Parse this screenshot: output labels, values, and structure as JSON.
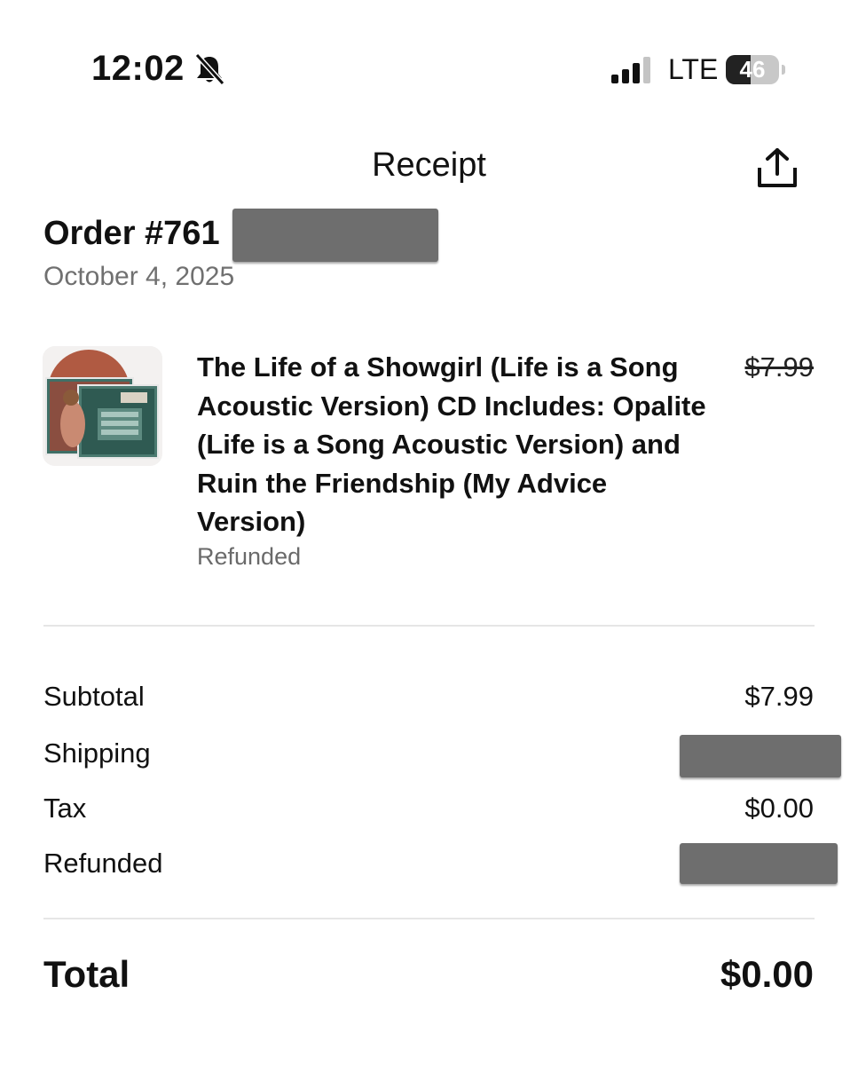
{
  "status_bar": {
    "time": "12:02",
    "silent_icon": "bell-slash-icon",
    "signal_icon": "cellular-signal-icon",
    "network": "LTE",
    "battery_level": "46",
    "battery_fraction": 0.46
  },
  "nav": {
    "title": "Receipt",
    "share_icon": "share-icon"
  },
  "order": {
    "number_prefix": "Order #761",
    "date": "October 4, 2025"
  },
  "item": {
    "title": "The Life of a Showgirl (Life is a Song Acoustic Version) CD Includes: Opalite (Life is a Song Acoustic Version) and Ruin the Friendship (My Advice Version)",
    "price": "$7.99",
    "status": "Refunded",
    "thumbnail_icon": "album-cover-image"
  },
  "summary": {
    "subtotal_label": "Subtotal",
    "subtotal_value": "$7.99",
    "shipping_label": "Shipping",
    "tax_label": "Tax",
    "tax_value": "$0.00",
    "refunded_label": "Refunded"
  },
  "total": {
    "label": "Total",
    "value": "$0.00"
  },
  "colors": {
    "redaction": "#6e6e6e",
    "muted_text": "#707070",
    "divider": "#e6e6e6"
  }
}
